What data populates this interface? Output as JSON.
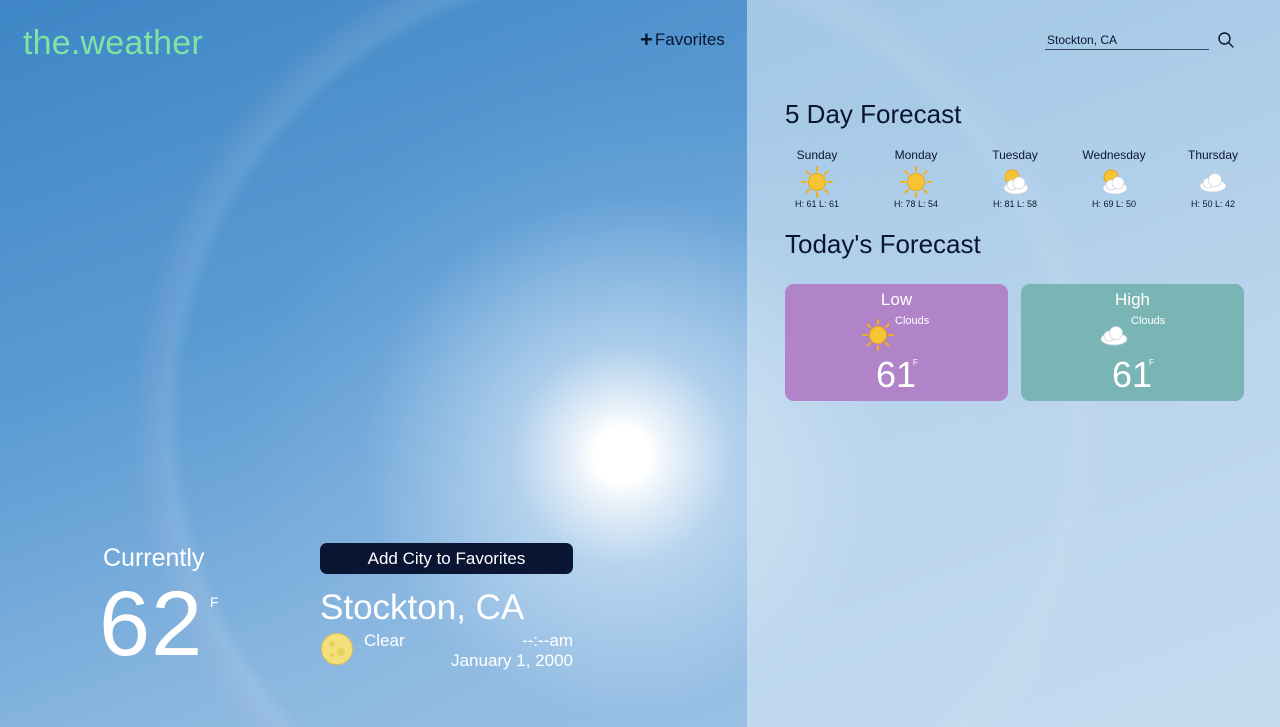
{
  "header": {
    "logo": "the.weather",
    "favorites_plus": "+",
    "favorites_label": "Favorites",
    "search_value": "Stockton, CA",
    "search_icon": "search-icon"
  },
  "five_day": {
    "title": "5 Day Forecast",
    "days": [
      {
        "name": "Sunday",
        "hl": "H: 61 L: 61",
        "icon": "sun-icon"
      },
      {
        "name": "Monday",
        "hl": "H: 78 L: 54",
        "icon": "sun-icon"
      },
      {
        "name": "Tuesday",
        "hl": "H: 81 L: 58",
        "icon": "partly-cloudy-icon"
      },
      {
        "name": "Wednesday",
        "hl": "H: 69 L: 50",
        "icon": "partly-cloudy-icon"
      },
      {
        "name": "Thursday",
        "hl": "H: 50 L: 42",
        "icon": "cloud-icon"
      }
    ]
  },
  "today": {
    "title": "Today's Forecast",
    "low": {
      "label": "Low",
      "desc": "Clouds",
      "temp": "61",
      "unit": "F",
      "icon": "sun-icon",
      "color": "#b184c9"
    },
    "high": {
      "label": "High",
      "desc": "Clouds",
      "temp": "61",
      "unit": "F",
      "icon": "cloud-icon",
      "color": "#79b5b5"
    }
  },
  "current": {
    "label": "Currently",
    "temp": "62",
    "unit": "F",
    "add_button": "Add City to Favorites",
    "city": "Stockton, CA",
    "condition": "Clear",
    "condition_icon": "moon-icon",
    "time": "--:--am",
    "date": "January 1, 2000"
  },
  "colors": {
    "logo": "#7fe3a3",
    "text_dark": "#0b1530",
    "button_bg": "#0a1533"
  }
}
